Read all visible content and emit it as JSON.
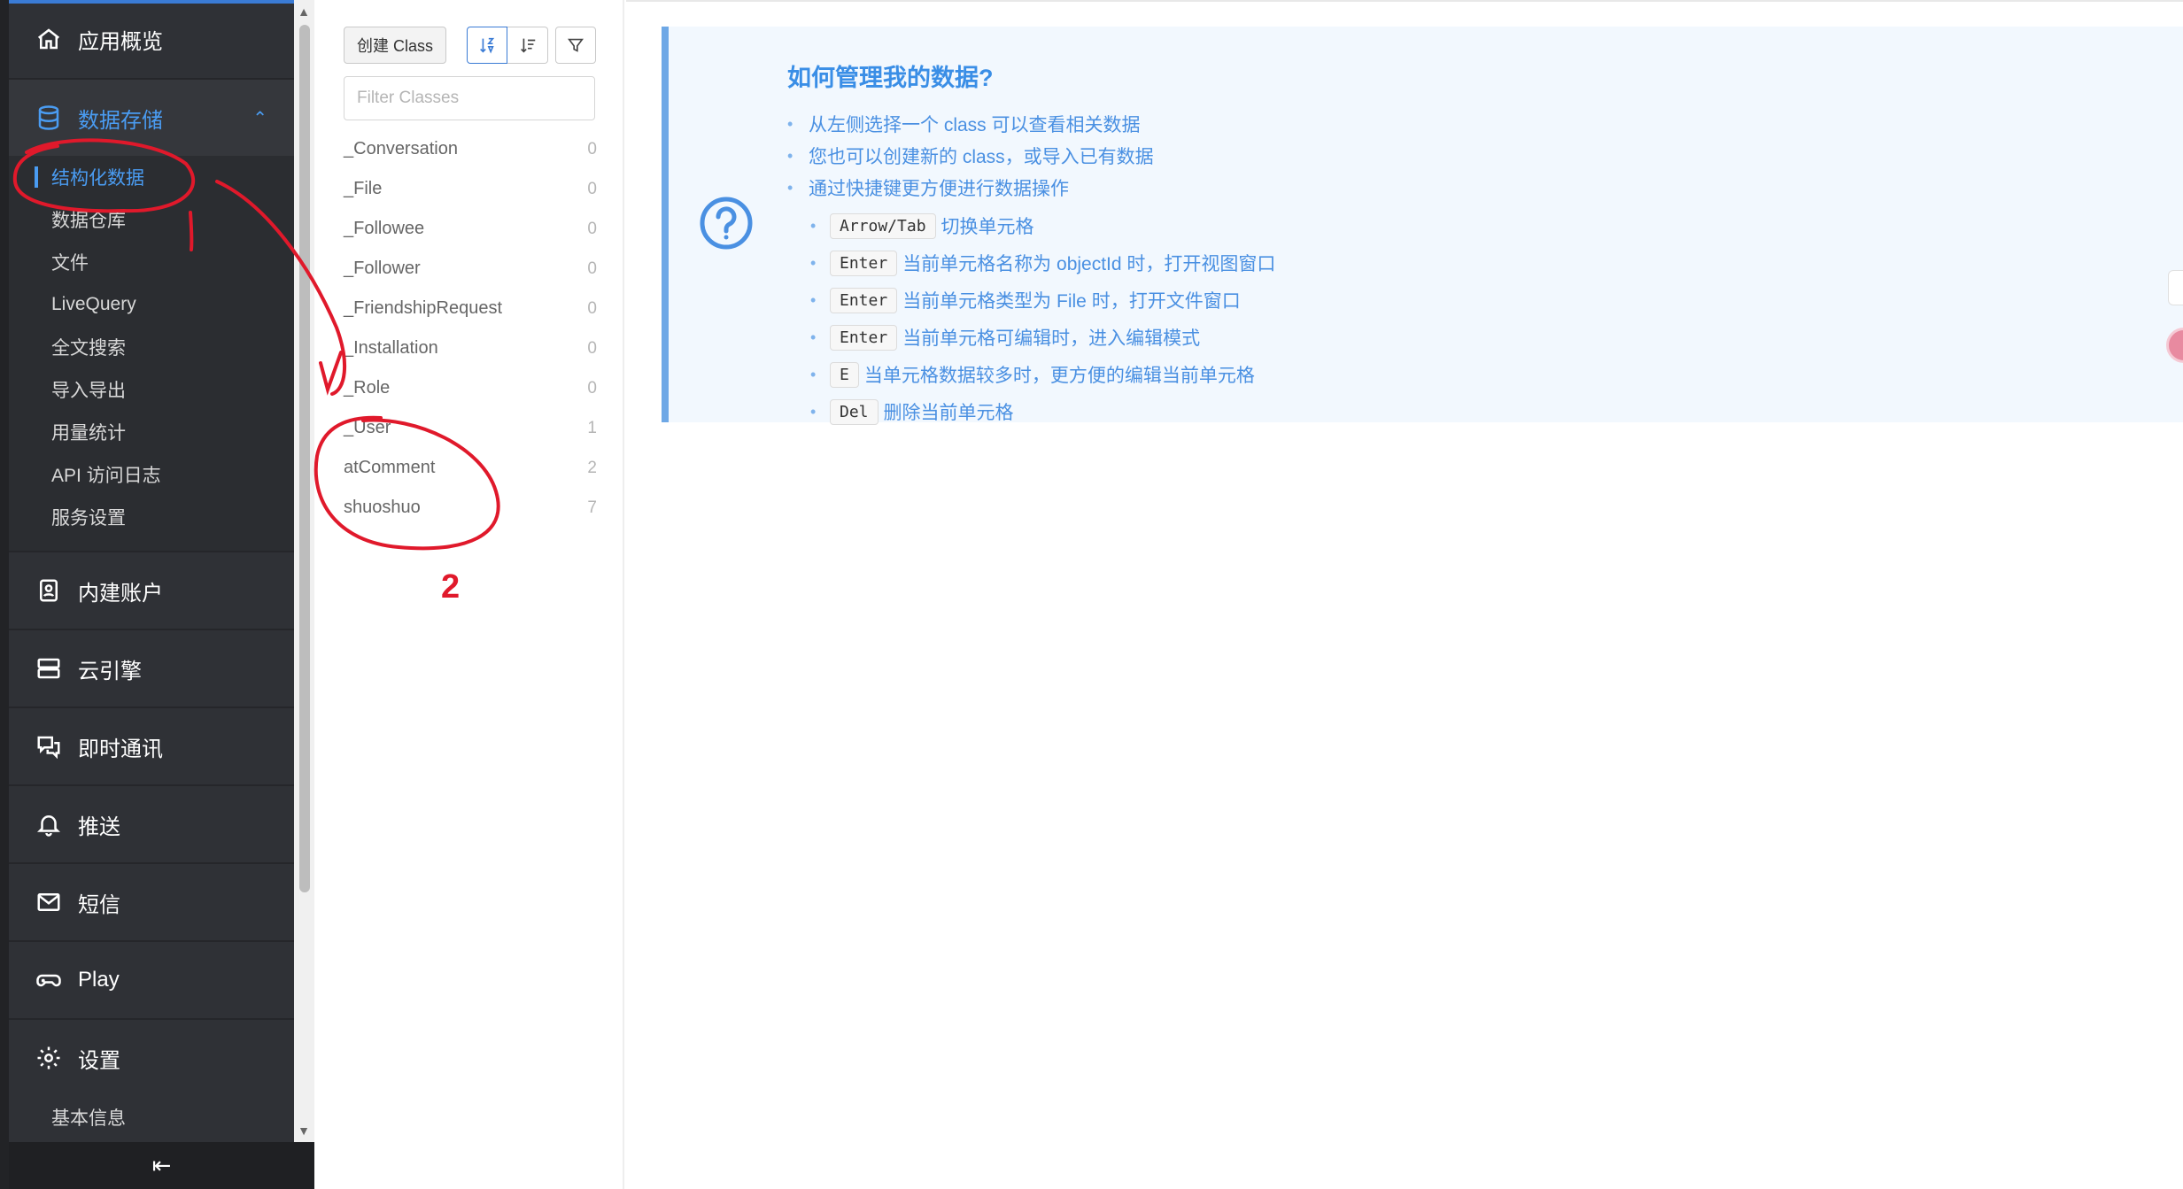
{
  "sidebar": {
    "overview": "应用概览",
    "storage": "数据存储",
    "storage_items": [
      "结构化数据",
      "数据仓库",
      "文件",
      "LiveQuery",
      "全文搜索",
      "导入导出",
      "用量统计",
      "API 访问日志",
      "服务设置"
    ],
    "auth": "内建账户",
    "engine": "云引擎",
    "im": "即时通讯",
    "push": "推送",
    "sms": "短信",
    "play": "Play",
    "settings": "设置",
    "settings_first": "基本信息",
    "collapse_icon": "collapse-left-icon"
  },
  "classes": {
    "create_label": "创建 Class",
    "filter_placeholder": "Filter Classes",
    "list": [
      {
        "name": "_Conversation",
        "count": "0"
      },
      {
        "name": "_File",
        "count": "0"
      },
      {
        "name": "_Followee",
        "count": "0"
      },
      {
        "name": "_Follower",
        "count": "0"
      },
      {
        "name": "_FriendshipRequest",
        "count": "0"
      },
      {
        "name": "_Installation",
        "count": "0"
      },
      {
        "name": "_Role",
        "count": "0"
      },
      {
        "name": "_User",
        "count": "1"
      },
      {
        "name": "atComment",
        "count": "2"
      },
      {
        "name": "shuoshuo",
        "count": "7"
      }
    ]
  },
  "help": {
    "title": "如何管理我的数据?",
    "bullets": [
      "从左侧选择一个 class 可以查看相关数据",
      "您也可以创建新的 class，或导入已有数据",
      "通过快捷键更方便进行数据操作"
    ],
    "shortcuts": [
      {
        "key": "Arrow/Tab",
        "desc": "切换单元格"
      },
      {
        "key": "Enter",
        "desc": "当前单元格名称为 objectId 时，打开视图窗口"
      },
      {
        "key": "Enter",
        "desc": "当前单元格类型为 File 时，打开文件窗口"
      },
      {
        "key": "Enter",
        "desc": "当前单元格可编辑时，进入编辑模式"
      },
      {
        "key": "E",
        "desc": "当单元格数据较多时，更方便的编辑当前单元格"
      },
      {
        "key": "Del",
        "desc": "删除当前单元格"
      }
    ]
  },
  "annotation": {
    "number_label": "2",
    "color": "#e0192b"
  },
  "colors": {
    "accent": "#3a7bd5",
    "sidebar_bg": "#2f3136",
    "help_bg": "#f2f8fe"
  }
}
